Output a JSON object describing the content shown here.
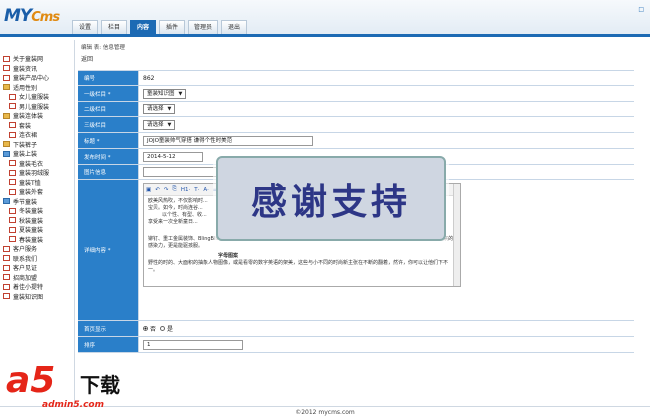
{
  "header": {
    "logo_main": "MY",
    "logo_accent": "Cms",
    "tabs": [
      {
        "label": "设置"
      },
      {
        "label": "栏目"
      },
      {
        "label": "内容",
        "active": true
      },
      {
        "label": "插件"
      },
      {
        "label": "管理员"
      },
      {
        "label": "退出"
      }
    ],
    "top_right": "□"
  },
  "sidebar": {
    "items": [
      {
        "label": "关于童装网",
        "icon": "page-icon",
        "sub": false
      },
      {
        "label": "童装资讯",
        "icon": "page-icon",
        "sub": false
      },
      {
        "label": "童装产品中心",
        "icon": "page-icon",
        "sub": false
      },
      {
        "label": "适用性别",
        "icon": "folder-icon",
        "sub": false
      },
      {
        "label": "女儿童服装",
        "icon": "page-icon",
        "sub": true
      },
      {
        "label": "男儿童服装",
        "icon": "page-icon",
        "sub": true
      },
      {
        "label": "童装连体装",
        "icon": "folder-icon",
        "sub": false
      },
      {
        "label": "套装",
        "icon": "page-icon",
        "sub": true
      },
      {
        "label": "连衣裙",
        "icon": "page-icon",
        "sub": true
      },
      {
        "label": "下装裤子",
        "icon": "folder-icon",
        "sub": false
      },
      {
        "label": "童装上装",
        "icon": "open-icon",
        "sub": false
      },
      {
        "label": "童装毛衣",
        "icon": "page-icon",
        "sub": true
      },
      {
        "label": "童装羽绒服",
        "icon": "page-icon",
        "sub": true
      },
      {
        "label": "童装T恤",
        "icon": "page-icon",
        "sub": true
      },
      {
        "label": "童装外套",
        "icon": "page-icon",
        "sub": true
      },
      {
        "label": "季节童装",
        "icon": "open-icon",
        "sub": false
      },
      {
        "label": "冬装童装",
        "icon": "page-icon",
        "sub": true
      },
      {
        "label": "秋装童装",
        "icon": "page-icon",
        "sub": true
      },
      {
        "label": "夏装童装",
        "icon": "page-icon",
        "sub": true
      },
      {
        "label": "春装童装",
        "icon": "page-icon",
        "sub": true
      },
      {
        "label": "客户服务",
        "icon": "page-icon",
        "sub": false
      },
      {
        "label": "联系我们",
        "icon": "page-icon",
        "sub": false
      },
      {
        "label": "客户见证",
        "icon": "page-icon",
        "sub": false
      },
      {
        "label": "招商加盟",
        "icon": "page-icon",
        "sub": false
      },
      {
        "label": "着佳小提特",
        "icon": "page-icon",
        "sub": false
      },
      {
        "label": "童装知识图",
        "icon": "page-icon",
        "sub": false
      }
    ]
  },
  "main": {
    "breadcrumb": "编辑 表: 信息管理",
    "back": "返回",
    "fields": {
      "id_label": "编号",
      "id_value": "862",
      "cat1_label": "一级栏目 *",
      "cat1_value": "童装知识图",
      "cat2_label": "二级栏目",
      "cat2_value": "请选择",
      "cat3_label": "三级栏目",
      "cat3_value": "请选择",
      "title_label": "标题 *",
      "title_value": "JOJO童装帅气穿搭 谦得个性时美范",
      "date_label": "发布时间 *",
      "date_value": "2014-5-12",
      "image_label": "图片信息",
      "detail_label": "详细内容 *",
      "home_label": "首页显示",
      "home_no": "否",
      "home_yes": "是",
      "sort_label": "排序",
      "sort_value": "1"
    },
    "editor": {
      "toolbar": [
        "▣",
        "↶",
        "↷",
        "⎘",
        "H1·",
        "T·",
        "A·",
        "⚌"
      ],
      "lines": [
        "欧美风热吹，不仅影响时...",
        "宝贝。如今，时尚连谷...",
        "以个性、有型、收...",
        "享受来一次全新童日..."
      ],
      "heading1": "朋友弹钉",
      "para1": "铆钉、重工金属装饰、BlingBling的闪光亮片，这些个性十足的图案元素是欧美式的童装中频出现元。这些酷酷的元素不仅让孩子们洞察的感染力，更是能驱孩服。",
      "heading2": "字母图案",
      "para2": "野性的时的、大面积的抽象人物图像，或是看零的数字英语的架美，这些与小不同的时尚新主张在不断的翻着，然许，你可以让他们下不一。"
    },
    "overlay": "感谢支持"
  },
  "footer": {
    "text": "©2012 mycms.com"
  },
  "watermark": {
    "big": "a5",
    "cn": "下载",
    "url": "admin5.com"
  }
}
